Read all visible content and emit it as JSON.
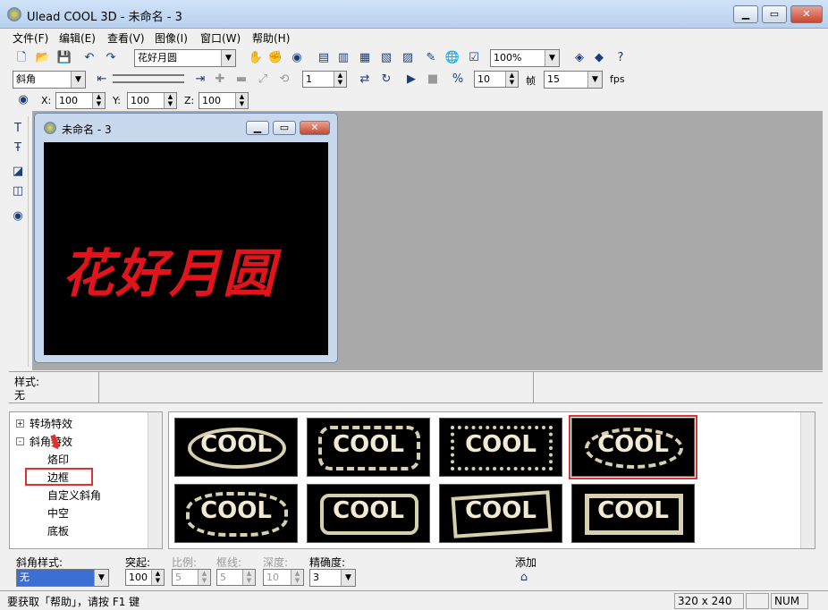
{
  "window": {
    "title": "Ulead COOL 3D - 未命名 - 3"
  },
  "menu": [
    "文件(F)",
    "编辑(E)",
    "查看(V)",
    "图像(I)",
    "窗口(W)",
    "帮助(H)"
  ],
  "toolbar": {
    "text_dropdown": "花好月圆",
    "zoom": "100%"
  },
  "toolbar2": {
    "object_dropdown": "斜角",
    "frame": "1",
    "frames_total": "10",
    "frames_label": "帧",
    "fps": "15",
    "fps_label": "fps"
  },
  "position": {
    "x_label": "X:",
    "x": "100",
    "y_label": "Y:",
    "y": "100",
    "z_label": "Z:",
    "z": "100"
  },
  "document": {
    "title": "未命名 - 3",
    "canvas_text": "花好月圆"
  },
  "style_info": {
    "label": "样式:",
    "value": "无"
  },
  "tree": [
    {
      "label": "转场特效",
      "expander": "+"
    },
    {
      "label": "斜角特效",
      "expander": "-"
    },
    {
      "label": "烙印"
    },
    {
      "label": "边框"
    },
    {
      "label": "自定义斜角"
    },
    {
      "label": "中空"
    },
    {
      "label": "底板"
    }
  ],
  "gallery": [
    "COOL",
    "COOL",
    "COOL",
    "COOL",
    "COOL",
    "COOL",
    "COOL",
    "COOL"
  ],
  "props": {
    "bevel_style_label": "斜角样式:",
    "bevel_style_value": "无",
    "extrude_label": "突起:",
    "extrude_value": "100",
    "ratio_label": "比例:",
    "ratio_value": "5",
    "frame_label": "框线:",
    "frame_value": "5",
    "depth_label": "深度:",
    "depth_value": "10",
    "precision_label": "精确度:",
    "precision_value": "3",
    "add_label": "添加"
  },
  "statusbar": {
    "help": "要获取「帮助」，请按 F1 键",
    "size": "320 x 240",
    "num": "NUM"
  },
  "colors": {
    "highlight": "#e03030",
    "canvas_text": "#e0141a"
  }
}
